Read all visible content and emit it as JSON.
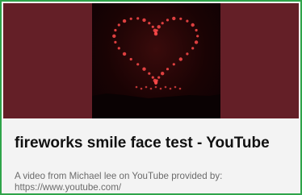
{
  "card": {
    "title": "fireworks smile face test - YouTube",
    "description": "A video from Michael lee on YouTube provided by: https://www.youtube.com/"
  },
  "colors": {
    "border": "#2fa44a",
    "thumbnail_bg": "#641f27",
    "firework": "#ff4a4a"
  }
}
